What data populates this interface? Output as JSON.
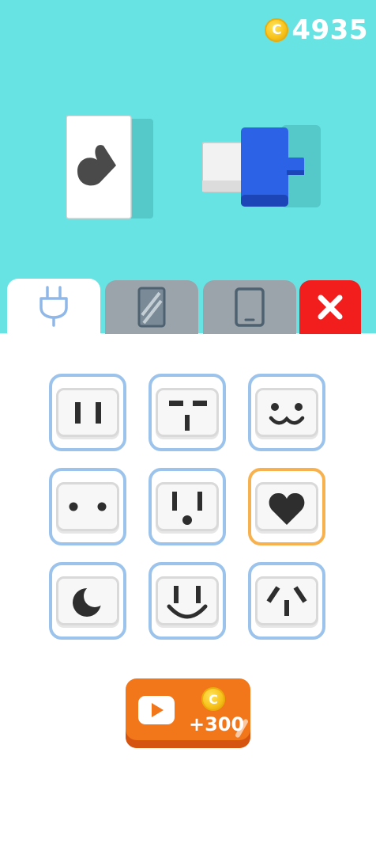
{
  "hud": {
    "coins": "4935",
    "coin_symbol": "C"
  },
  "scene": {
    "socket_shape": "heart",
    "plug_color": "#2b62e6",
    "background_color": "#67e3e4"
  },
  "tabs": [
    {
      "name": "plug",
      "icon": "plug-icon",
      "active": true
    },
    {
      "name": "frame",
      "icon": "mirror-frame-icon",
      "active": false
    },
    {
      "name": "device",
      "icon": "tablet-icon",
      "active": false
    },
    {
      "name": "close",
      "icon": "close-icon",
      "active": false
    }
  ],
  "socket_options": [
    {
      "shape": "two-slots",
      "selected": false
    },
    {
      "shape": "t-slots",
      "selected": false
    },
    {
      "shape": "cat-face",
      "selected": false
    },
    {
      "shape": "two-dots",
      "selected": false
    },
    {
      "shape": "surprised-face",
      "selected": false
    },
    {
      "shape": "heart",
      "selected": true
    },
    {
      "shape": "crescent-moon",
      "selected": false
    },
    {
      "shape": "smile-face",
      "selected": false
    },
    {
      "shape": "angled-slots",
      "selected": false
    }
  ],
  "reward": {
    "amount": "+300",
    "coin_symbol": "C",
    "icon": "video-play-icon"
  },
  "colors": {
    "selected_border": "#f7b24f",
    "tile_border": "#9bc3ec",
    "close_red": "#f21d1d",
    "reward_orange": "#f2761a"
  }
}
